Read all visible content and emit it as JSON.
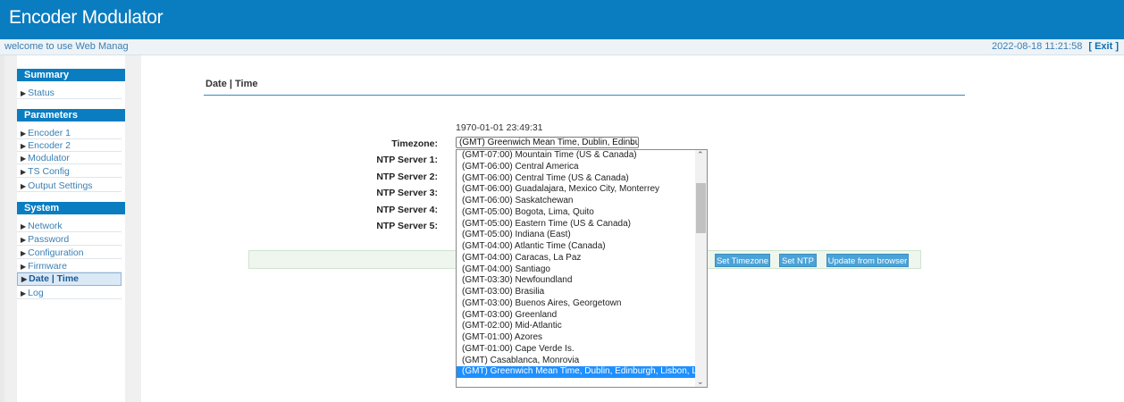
{
  "header": {
    "title": "Encoder Modulator"
  },
  "infobar": {
    "welcome": "welcome to use Web Manag",
    "datetime": "2022-08-18 11:21:58",
    "exit": "[ Exit ]"
  },
  "sidebar": {
    "summary": {
      "title": "Summary",
      "items": [
        "Status"
      ]
    },
    "parameters": {
      "title": "Parameters",
      "items": [
        "Encoder 1",
        "Encoder 2",
        "Modulator",
        "TS Config",
        "Output Settings"
      ]
    },
    "system": {
      "title": "System",
      "items": [
        "Network",
        "Password",
        "Configuration",
        "Firmware",
        "Date | Time",
        "Log"
      ],
      "active": "Date | Time"
    }
  },
  "main": {
    "breadcrumb": "Date | Time",
    "current_time": "1970-01-01 23:49:31",
    "labels": {
      "timezone": "Timezone:",
      "ntp1": "NTP Server 1:",
      "ntp2": "NTP Server 2:",
      "ntp3": "NTP Server 3:",
      "ntp4": "NTP Server 4:",
      "ntp5": "NTP Server 5:"
    },
    "timezone_selected": "(GMT) Greenwich Mean Time, Dublin, Edinburg",
    "buttons": {
      "set_timezone": "Set Timezone",
      "set_ntp": "Set NTP",
      "update_browser": "Update from browser"
    }
  },
  "dropdown": {
    "options": [
      "(GMT-07:00) Mountain Time (US & Canada)",
      "(GMT-06:00) Central America",
      "(GMT-06:00) Central Time (US & Canada)",
      "(GMT-06:00) Guadalajara, Mexico City, Monterrey",
      "(GMT-06:00) Saskatchewan",
      "(GMT-05:00) Bogota, Lima, Quito",
      "(GMT-05:00) Eastern Time (US & Canada)",
      "(GMT-05:00) Indiana (East)",
      "(GMT-04:00) Atlantic Time (Canada)",
      "(GMT-04:00) Caracas, La Paz",
      "(GMT-04:00) Santiago",
      "(GMT-03:30) Newfoundland",
      "(GMT-03:00) Brasilia",
      "(GMT-03:00) Buenos Aires, Georgetown",
      "(GMT-03:00) Greenland",
      "(GMT-02:00) Mid-Atlantic",
      "(GMT-01:00) Azores",
      "(GMT-01:00) Cape Verde Is.",
      "(GMT) Casablanca, Monrovia",
      "(GMT) Greenwich Mean Time, Dublin, Edinburgh, Lisbon, London"
    ],
    "selected_index": 19
  },
  "colors": {
    "brand": "#0a7cc0",
    "button": "#4aa3d8",
    "selected": "#1e90ff"
  }
}
